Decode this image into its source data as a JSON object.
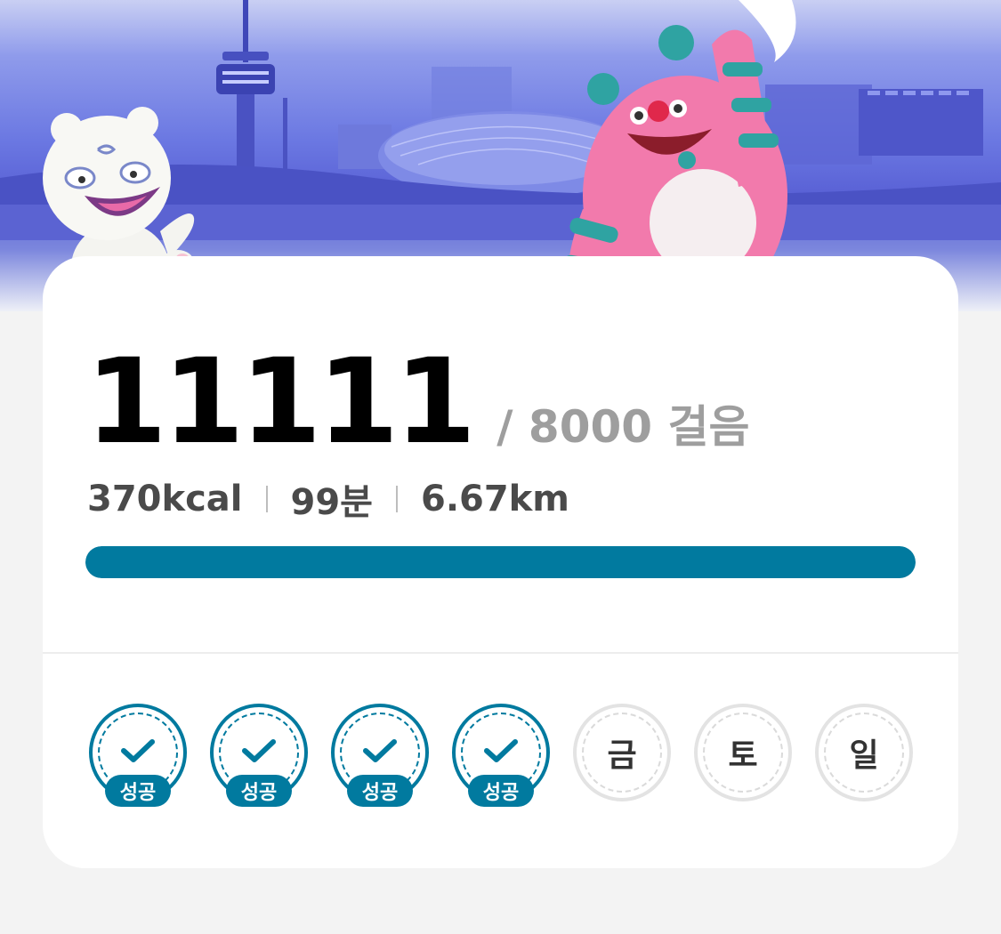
{
  "summary": {
    "steps": "11111",
    "goal_text": "/ 8000 걸음",
    "calories": "370kcal",
    "minutes": "99분",
    "distance": "6.67km",
    "progress_fraction": 1.0
  },
  "week": [
    {
      "state": "done",
      "label": "성공"
    },
    {
      "state": "done",
      "label": "성공"
    },
    {
      "state": "done",
      "label": "성공"
    },
    {
      "state": "done",
      "label": "성공"
    },
    {
      "state": "pending",
      "label": "금"
    },
    {
      "state": "pending",
      "label": "토"
    },
    {
      "state": "pending",
      "label": "일"
    }
  ],
  "colors": {
    "accent": "#017a9f",
    "goal_text": "#9e9e9e",
    "pending_ring": "#e3e3e3"
  },
  "icons": [
    "check-icon",
    "moon-icon",
    "tower-icon",
    "pink-monster-mascot",
    "white-tiger-mascot"
  ]
}
